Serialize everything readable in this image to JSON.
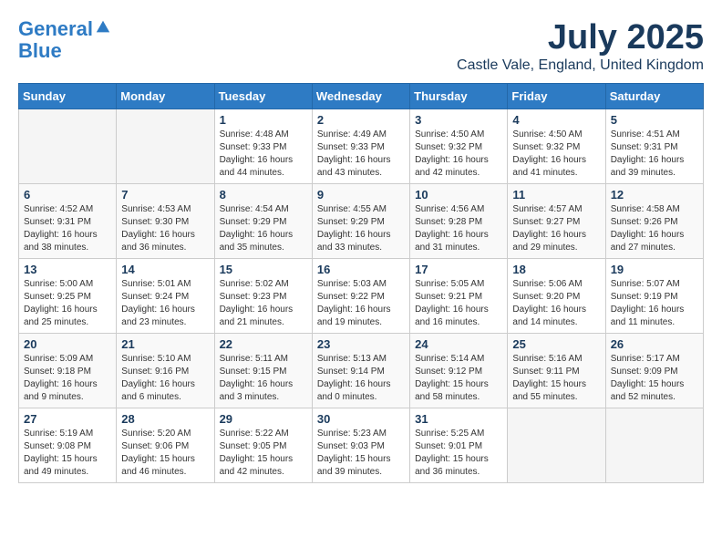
{
  "header": {
    "logo_line1": "General",
    "logo_line2": "Blue",
    "month": "July 2025",
    "location": "Castle Vale, England, United Kingdom"
  },
  "days_of_week": [
    "Sunday",
    "Monday",
    "Tuesday",
    "Wednesday",
    "Thursday",
    "Friday",
    "Saturday"
  ],
  "weeks": [
    [
      {
        "day": "",
        "content": ""
      },
      {
        "day": "",
        "content": ""
      },
      {
        "day": "1",
        "content": "Sunrise: 4:48 AM\nSunset: 9:33 PM\nDaylight: 16 hours and 44 minutes."
      },
      {
        "day": "2",
        "content": "Sunrise: 4:49 AM\nSunset: 9:33 PM\nDaylight: 16 hours and 43 minutes."
      },
      {
        "day": "3",
        "content": "Sunrise: 4:50 AM\nSunset: 9:32 PM\nDaylight: 16 hours and 42 minutes."
      },
      {
        "day": "4",
        "content": "Sunrise: 4:50 AM\nSunset: 9:32 PM\nDaylight: 16 hours and 41 minutes."
      },
      {
        "day": "5",
        "content": "Sunrise: 4:51 AM\nSunset: 9:31 PM\nDaylight: 16 hours and 39 minutes."
      }
    ],
    [
      {
        "day": "6",
        "content": "Sunrise: 4:52 AM\nSunset: 9:31 PM\nDaylight: 16 hours and 38 minutes."
      },
      {
        "day": "7",
        "content": "Sunrise: 4:53 AM\nSunset: 9:30 PM\nDaylight: 16 hours and 36 minutes."
      },
      {
        "day": "8",
        "content": "Sunrise: 4:54 AM\nSunset: 9:29 PM\nDaylight: 16 hours and 35 minutes."
      },
      {
        "day": "9",
        "content": "Sunrise: 4:55 AM\nSunset: 9:29 PM\nDaylight: 16 hours and 33 minutes."
      },
      {
        "day": "10",
        "content": "Sunrise: 4:56 AM\nSunset: 9:28 PM\nDaylight: 16 hours and 31 minutes."
      },
      {
        "day": "11",
        "content": "Sunrise: 4:57 AM\nSunset: 9:27 PM\nDaylight: 16 hours and 29 minutes."
      },
      {
        "day": "12",
        "content": "Sunrise: 4:58 AM\nSunset: 9:26 PM\nDaylight: 16 hours and 27 minutes."
      }
    ],
    [
      {
        "day": "13",
        "content": "Sunrise: 5:00 AM\nSunset: 9:25 PM\nDaylight: 16 hours and 25 minutes."
      },
      {
        "day": "14",
        "content": "Sunrise: 5:01 AM\nSunset: 9:24 PM\nDaylight: 16 hours and 23 minutes."
      },
      {
        "day": "15",
        "content": "Sunrise: 5:02 AM\nSunset: 9:23 PM\nDaylight: 16 hours and 21 minutes."
      },
      {
        "day": "16",
        "content": "Sunrise: 5:03 AM\nSunset: 9:22 PM\nDaylight: 16 hours and 19 minutes."
      },
      {
        "day": "17",
        "content": "Sunrise: 5:05 AM\nSunset: 9:21 PM\nDaylight: 16 hours and 16 minutes."
      },
      {
        "day": "18",
        "content": "Sunrise: 5:06 AM\nSunset: 9:20 PM\nDaylight: 16 hours and 14 minutes."
      },
      {
        "day": "19",
        "content": "Sunrise: 5:07 AM\nSunset: 9:19 PM\nDaylight: 16 hours and 11 minutes."
      }
    ],
    [
      {
        "day": "20",
        "content": "Sunrise: 5:09 AM\nSunset: 9:18 PM\nDaylight: 16 hours and 9 minutes."
      },
      {
        "day": "21",
        "content": "Sunrise: 5:10 AM\nSunset: 9:16 PM\nDaylight: 16 hours and 6 minutes."
      },
      {
        "day": "22",
        "content": "Sunrise: 5:11 AM\nSunset: 9:15 PM\nDaylight: 16 hours and 3 minutes."
      },
      {
        "day": "23",
        "content": "Sunrise: 5:13 AM\nSunset: 9:14 PM\nDaylight: 16 hours and 0 minutes."
      },
      {
        "day": "24",
        "content": "Sunrise: 5:14 AM\nSunset: 9:12 PM\nDaylight: 15 hours and 58 minutes."
      },
      {
        "day": "25",
        "content": "Sunrise: 5:16 AM\nSunset: 9:11 PM\nDaylight: 15 hours and 55 minutes."
      },
      {
        "day": "26",
        "content": "Sunrise: 5:17 AM\nSunset: 9:09 PM\nDaylight: 15 hours and 52 minutes."
      }
    ],
    [
      {
        "day": "27",
        "content": "Sunrise: 5:19 AM\nSunset: 9:08 PM\nDaylight: 15 hours and 49 minutes."
      },
      {
        "day": "28",
        "content": "Sunrise: 5:20 AM\nSunset: 9:06 PM\nDaylight: 15 hours and 46 minutes."
      },
      {
        "day": "29",
        "content": "Sunrise: 5:22 AM\nSunset: 9:05 PM\nDaylight: 15 hours and 42 minutes."
      },
      {
        "day": "30",
        "content": "Sunrise: 5:23 AM\nSunset: 9:03 PM\nDaylight: 15 hours and 39 minutes."
      },
      {
        "day": "31",
        "content": "Sunrise: 5:25 AM\nSunset: 9:01 PM\nDaylight: 15 hours and 36 minutes."
      },
      {
        "day": "",
        "content": ""
      },
      {
        "day": "",
        "content": ""
      }
    ]
  ]
}
